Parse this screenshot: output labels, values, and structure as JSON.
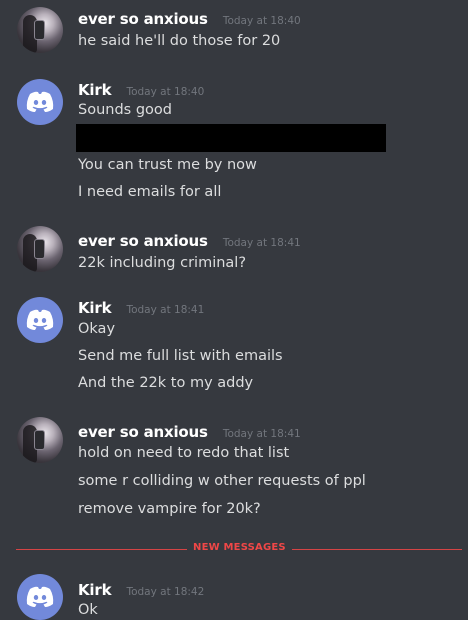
{
  "messages": [
    {
      "author": "ever so anxious",
      "timestamp": "Today at 18:40",
      "lines": [
        "he said he'll do those for 20"
      ]
    },
    {
      "author": "Kirk",
      "timestamp": "Today at 18:40",
      "lines": [
        "Sounds good",
        "You can trust me by now",
        "I need emails for all"
      ]
    },
    {
      "author": "ever so anxious",
      "timestamp": "Today at 18:41",
      "lines": [
        "22k including criminal?"
      ]
    },
    {
      "author": "Kirk",
      "timestamp": "Today at 18:41",
      "lines": [
        "Okay",
        "Send me full list with emails",
        "And the 22k to my addy"
      ]
    },
    {
      "author": "ever so anxious",
      "timestamp": "Today at 18:41",
      "lines": [
        "hold on need to redo that list",
        "some r colliding w other requests of ppl",
        "remove vampire for 20k?"
      ]
    },
    {
      "author": "Kirk",
      "timestamp": "Today at 18:42",
      "lines": [
        "Ok"
      ]
    }
  ],
  "divider": {
    "label": "NEW MESSAGES"
  },
  "colors": {
    "background": "#36393f",
    "username": "#ffffff",
    "timestamp": "#72767d",
    "message_text": "#dcddde",
    "discord_blurple": "#7289da",
    "new_messages_red": "#f04747"
  },
  "icons": {
    "bot_avatar": "discord-logo-icon",
    "user_avatar": "profile-photo"
  }
}
